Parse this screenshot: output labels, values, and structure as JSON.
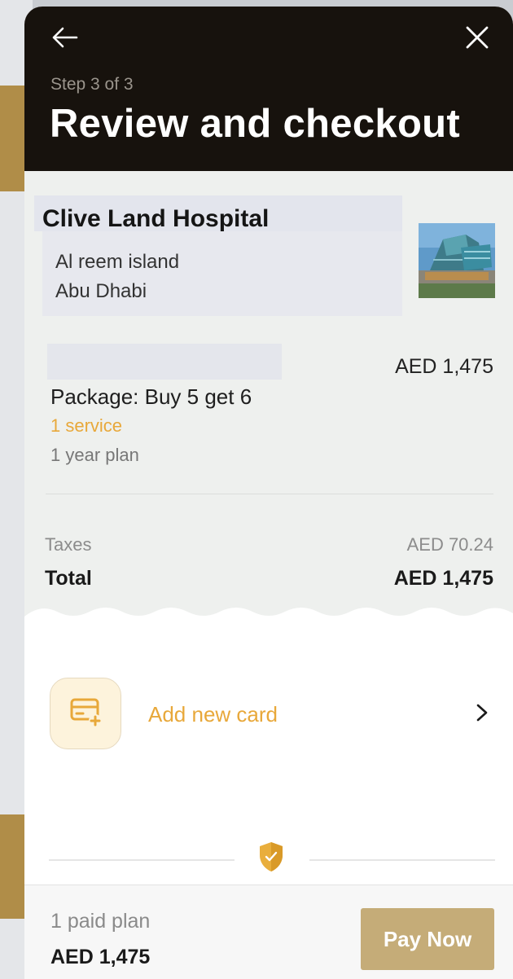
{
  "header": {
    "step": "Step 3 of 3",
    "title": "Review and checkout",
    "back_icon": "arrow-left-icon",
    "close_icon": "close-icon"
  },
  "hospital": {
    "name": "Clive Land Hospital",
    "address_line1": "Al reem island",
    "address_line2": "Abu Dhabi"
  },
  "package": {
    "price": "AED 1,475",
    "name": "Package: Buy 5 get 6",
    "services": "1 service",
    "plan": "1 year plan"
  },
  "totals": {
    "taxes_label": "Taxes",
    "taxes_value": "AED 70.24",
    "total_label": "Total",
    "total_value": "AED 1,475"
  },
  "payment": {
    "add_card_label": "Add new card",
    "card_icon": "credit-card-add-icon",
    "chevron_icon": "chevron-right-icon"
  },
  "footer": {
    "paid_plans": "1 paid plan",
    "total": "AED 1,475",
    "pay_button": "Pay Now"
  },
  "colors": {
    "header_bg": "#17120d",
    "accent_orange": "#e8a83a",
    "pay_button_bg": "#c5ac78",
    "backdrop_gold": "#b08d48"
  }
}
